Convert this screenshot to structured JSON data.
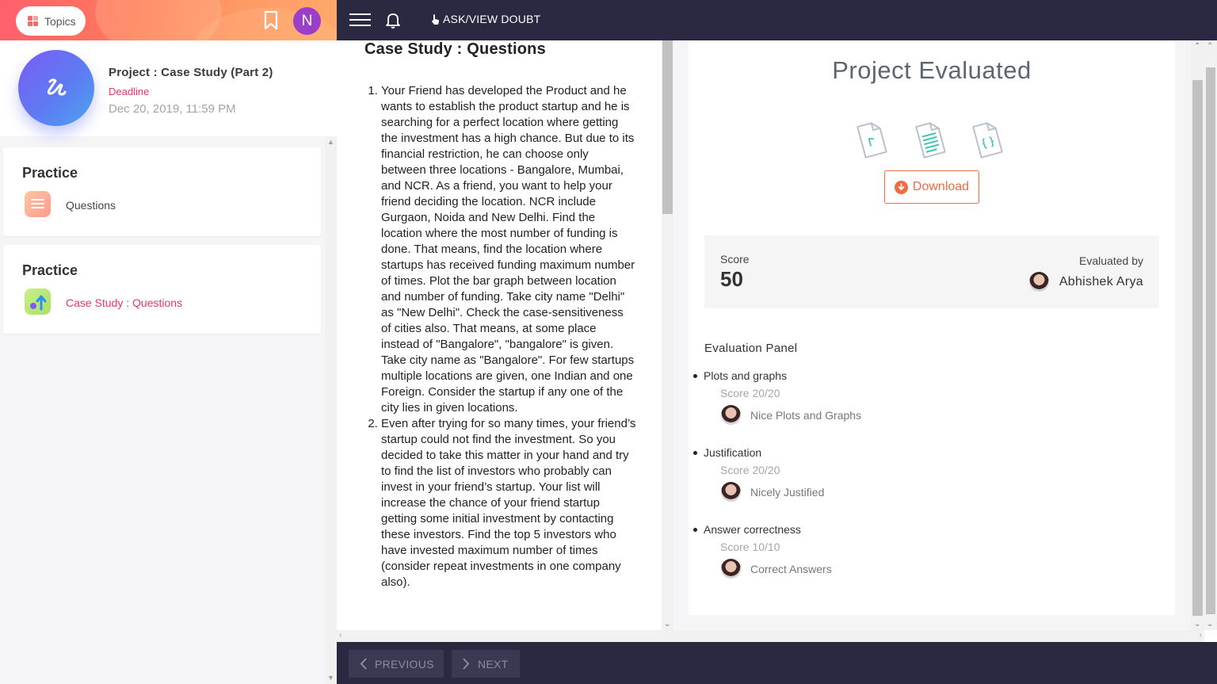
{
  "left": {
    "topics_label": "Topics",
    "avatar_letter": "N",
    "project_title": "Project : Case Study (Part 2)",
    "deadline_label": "Deadline",
    "deadline_value": "Dec 20, 2019, 11:59 PM",
    "practice": [
      {
        "title": "Practice",
        "item_label": "Questions",
        "active": false
      },
      {
        "title": "Practice",
        "item_label": "Case Study : Questions",
        "active": true
      }
    ]
  },
  "topnav": {
    "ask_doubt_label": "ASK/VIEW DOUBT"
  },
  "questions": {
    "title": "Case Study : Questions",
    "items": [
      "Your Friend has developed the Product and he wants to establish the product startup and he is searching for a perfect location where getting the investment has a high chance. But due to its financial restriction, he can choose only between three locations -  Bangalore, Mumbai, and NCR. As a friend, you want to help your friend deciding the location. NCR include Gurgaon, Noida and New Delhi. Find the location where the most number of funding is done. That means, find the location where startups has received funding maximum number of times. Plot the bar graph between location and number of funding. Take city name \"Delhi\" as \"New Delhi\". Check the case-sensitiveness of cities also. That means, at some place instead of \"Bangalore\", \"bangalore\" is given. Take city name as \"Bangalore\". For few startups multiple locations are given, one Indian and one Foreign. Consider the startup if any one of the city lies in given locations.",
      "Even after trying for so many times, your friend’s startup could not find the investment. So you decided to take this matter in your hand and try to find the list of investors who probably can invest in your friend’s startup. Your list will increase the chance of your friend startup getting some initial investment by contacting these investors. Find the top 5 investors who have invested maximum number of times (consider repeat investments in one company also)."
    ]
  },
  "evaluation": {
    "title": "Project Evaluated",
    "download_label": "Download",
    "score_label": "Score",
    "score_value": "50",
    "evaluated_by_label": "Evaluated by",
    "evaluator_name": "Abhishek Arya",
    "panel_title": "Evaluation Panel",
    "criteria": [
      {
        "name": "Plots and graphs",
        "score": "Score 20/20",
        "comment": "Nice Plots and Graphs"
      },
      {
        "name": "Justification",
        "score": "Score 20/20",
        "comment": "Nicely Justified"
      },
      {
        "name": "Answer correctness",
        "score": "Score 10/10",
        "comment": "Correct Answers"
      }
    ]
  },
  "bottomnav": {
    "previous_label": "PREVIOUS",
    "next_label": "NEXT"
  },
  "colors": {
    "nav_bg": "#2b2942",
    "accent_pink": "#e8356a",
    "download_orange": "#f26a3f",
    "avatar_purple": "#9b3fc8"
  },
  "icons": [
    "topics-grid-icon",
    "bookmark-icon",
    "hamburger-icon",
    "bell-icon",
    "hand-icon",
    "file-code-icon",
    "file-text-icon",
    "file-json-icon",
    "download-icon",
    "chevron-left-icon",
    "chevron-right-icon"
  ]
}
